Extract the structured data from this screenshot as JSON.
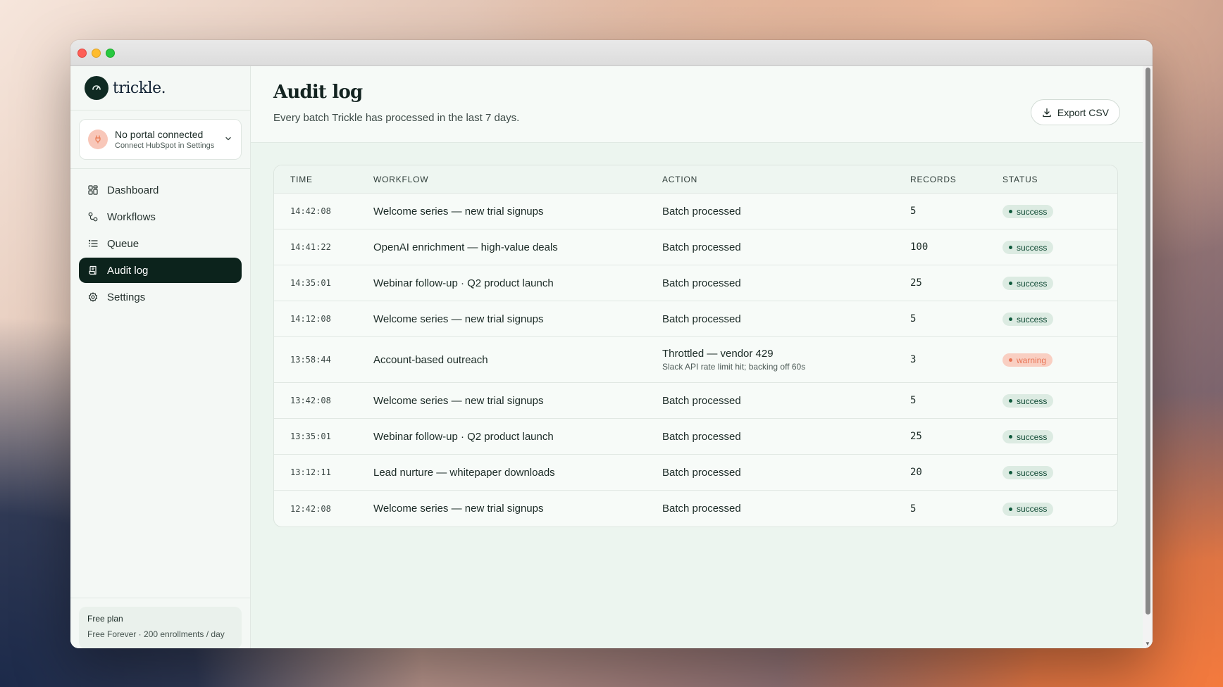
{
  "brand": {
    "name": "trickle."
  },
  "portal": {
    "title": "No portal connected",
    "subtitle": "Connect HubSpot in Settings"
  },
  "nav": [
    {
      "label": "Dashboard",
      "icon": "grid-icon",
      "active": false
    },
    {
      "label": "Workflows",
      "icon": "workflow-icon",
      "active": false
    },
    {
      "label": "Queue",
      "icon": "list-icon",
      "active": false
    },
    {
      "label": "Audit log",
      "icon": "scroll-icon",
      "active": true
    },
    {
      "label": "Settings",
      "icon": "gear-icon",
      "active": false
    }
  ],
  "plan": {
    "title": "Free plan",
    "subtitle": "Free Forever · 200 enrollments / day"
  },
  "page": {
    "title": "Audit log",
    "subtitle": "Every batch Trickle has processed in the last 7 days.",
    "export_label": "Export CSV"
  },
  "table": {
    "columns": [
      "TIME",
      "WORKFLOW",
      "ACTION",
      "RECORDS",
      "STATUS"
    ],
    "rows": [
      {
        "time": "14:42:08",
        "workflow": "Welcome series — new trial signups",
        "action": "Batch processed",
        "detail": "",
        "records": "5",
        "status": "success"
      },
      {
        "time": "14:41:22",
        "workflow": "OpenAI enrichment — high-value deals",
        "action": "Batch processed",
        "detail": "",
        "records": "100",
        "status": "success"
      },
      {
        "time": "14:35:01",
        "workflow": "Webinar follow-up · Q2 product launch",
        "action": "Batch processed",
        "detail": "",
        "records": "25",
        "status": "success"
      },
      {
        "time": "14:12:08",
        "workflow": "Welcome series — new trial signups",
        "action": "Batch processed",
        "detail": "",
        "records": "5",
        "status": "success"
      },
      {
        "time": "13:58:44",
        "workflow": "Account-based outreach",
        "action": "Throttled — vendor 429",
        "detail": "Slack API rate limit hit; backing off 60s",
        "records": "3",
        "status": "warning"
      },
      {
        "time": "13:42:08",
        "workflow": "Welcome series — new trial signups",
        "action": "Batch processed",
        "detail": "",
        "records": "5",
        "status": "success"
      },
      {
        "time": "13:35:01",
        "workflow": "Webinar follow-up · Q2 product launch",
        "action": "Batch processed",
        "detail": "",
        "records": "25",
        "status": "success"
      },
      {
        "time": "13:12:11",
        "workflow": "Lead nurture — whitepaper downloads",
        "action": "Batch processed",
        "detail": "",
        "records": "20",
        "status": "success"
      },
      {
        "time": "12:42:08",
        "workflow": "Welcome series — new trial signups",
        "action": "Batch processed",
        "detail": "",
        "records": "5",
        "status": "success"
      }
    ]
  },
  "colors": {
    "accent": "#0c231c",
    "success": "#0f5a3c",
    "warning": "#e87556"
  }
}
